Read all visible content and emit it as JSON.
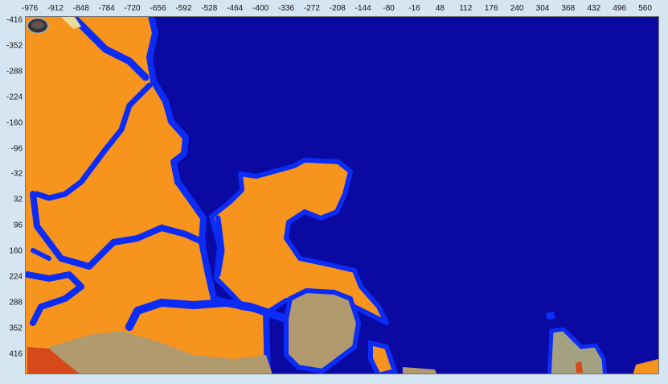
{
  "axes": {
    "x_labels": [
      "-976",
      "-912",
      "-848",
      "-784",
      "-720",
      "-656",
      "-592",
      "-528",
      "-464",
      "-400",
      "-336",
      "-272",
      "-208",
      "-144",
      "-80",
      "-16",
      "48",
      "112",
      "176",
      "240",
      "304",
      "368",
      "432",
      "496",
      "560"
    ],
    "y_labels": [
      "-416",
      "-352",
      "-288",
      "-224",
      "-160",
      "-96",
      "-32",
      "32",
      "96",
      "160",
      "224",
      "288",
      "352",
      "416"
    ]
  },
  "colors": {
    "deep_ocean": "#0a0aa3",
    "river": "#0b2cf6",
    "land": "#f7941d",
    "tan": "#b09a6e",
    "sand": "#e8dc9c",
    "red": "#d64a1a",
    "gray": "#a3a17f"
  },
  "marker": {
    "icon": "player-compass-icon"
  }
}
